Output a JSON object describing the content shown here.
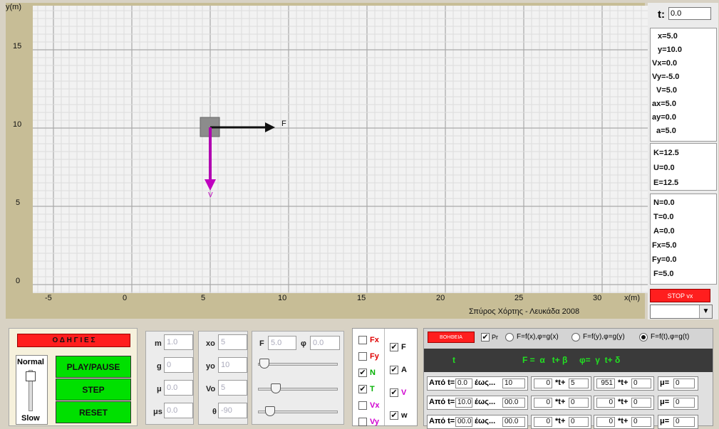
{
  "plot": {
    "y_axis_label": "y(m)",
    "x_axis_label": "x(m)",
    "y_ticks": [
      "15",
      "10",
      "5",
      "0"
    ],
    "x_ticks": [
      "-5",
      "0",
      "5",
      "10",
      "15",
      "20",
      "25",
      "30"
    ],
    "force_label": "F",
    "velocity_label": "V",
    "credit": "Σπύρος Χόρτης - Λευκάδα 2008"
  },
  "time": {
    "label": "t:",
    "value": "0.0"
  },
  "kinematics": [
    "x=5.0",
    "y=10.0",
    "Vx=0.0",
    "Vy=-5.0",
    "V=5.0",
    "ax=5.0",
    "ay=0.0",
    "a=5.0"
  ],
  "energy": [
    "K=12.5",
    "U=0.0",
    "E=12.5"
  ],
  "forces": [
    "N=0.0",
    "T=0.0",
    "A=0.0",
    "Fx=5.0",
    "Fy=0.0",
    "F=5.0"
  ],
  "stop_button": "STOP vx",
  "instructions_button": "Ο Δ Η Γ Ι Ε Σ",
  "speed": {
    "top": "Normal",
    "bottom": "Slow"
  },
  "controls": {
    "play_pause": "PLAY/PAUSE",
    "step": "STEP",
    "reset": "RESET"
  },
  "params1": [
    {
      "label": "m",
      "value": "1.0"
    },
    {
      "label": "g",
      "value": "0"
    },
    {
      "label": "μ",
      "value": "0.0"
    },
    {
      "label": "μs",
      "value": "0.0"
    }
  ],
  "params2": [
    {
      "label": "xo",
      "value": "5"
    },
    {
      "label": "yo",
      "value": "10"
    },
    {
      "label": "Vo",
      "value": "5"
    },
    {
      "label": "θ",
      "value": "-90"
    }
  ],
  "force_params": {
    "f_label": "F",
    "f_value": "5.0",
    "phi_label": "φ",
    "phi_value": "0.0"
  },
  "sliders": [
    0.02,
    0.18,
    0.1
  ],
  "checks_left": [
    {
      "label": "Fx",
      "checked": false,
      "color": "#e00000"
    },
    {
      "label": "Fy",
      "checked": false,
      "color": "#e00000"
    },
    {
      "label": "N",
      "checked": true,
      "color": "#00b000"
    },
    {
      "label": "T",
      "checked": true,
      "color": "#00b000"
    },
    {
      "label": "Vx",
      "checked": false,
      "color": "#d000d0"
    },
    {
      "label": "Vy",
      "checked": false,
      "color": "#d000d0"
    }
  ],
  "checks_right": [
    {
      "label": "F",
      "checked": true,
      "color": "#111111"
    },
    {
      "label": "A",
      "checked": true,
      "color": "#111111"
    },
    {
      "label": "V",
      "checked": true,
      "color": "#d000d0"
    },
    {
      "label": "w",
      "checked": true,
      "color": "#111111"
    }
  ],
  "func": {
    "help_button": "ΒΟΗΘΕΙΑ",
    "pr_label": "Pr",
    "radio1": "F=f(x),φ=g(x)",
    "radio2": "F=f(y),φ=g(y)",
    "radio3": "F=f(t),φ=g(t)",
    "header_t": "t",
    "header_formula": "F =  α   t+ β     φ=  γ  t+ δ",
    "rows": [
      {
        "from_label": "Από t=",
        "from": "0.0",
        "to_label": "έως...",
        "to": "10",
        "a": "0",
        "b": "5",
        "c": "951",
        "d": "0",
        "mu": "0"
      },
      {
        "from_label": "Από t=",
        "from": "10.0",
        "to_label": "έως...",
        "to": "00.0",
        "a": "0",
        "b": "0",
        "c": "0",
        "d": "0",
        "mu": "0"
      },
      {
        "from_label": "Από t=",
        "from": "00.0",
        "to_label": "έως...",
        "to": "00.0",
        "a": "0",
        "b": "0",
        "c": "0",
        "d": "0",
        "mu": "0"
      }
    ],
    "t_plus": "*t+",
    "mu_label": "μ="
  }
}
